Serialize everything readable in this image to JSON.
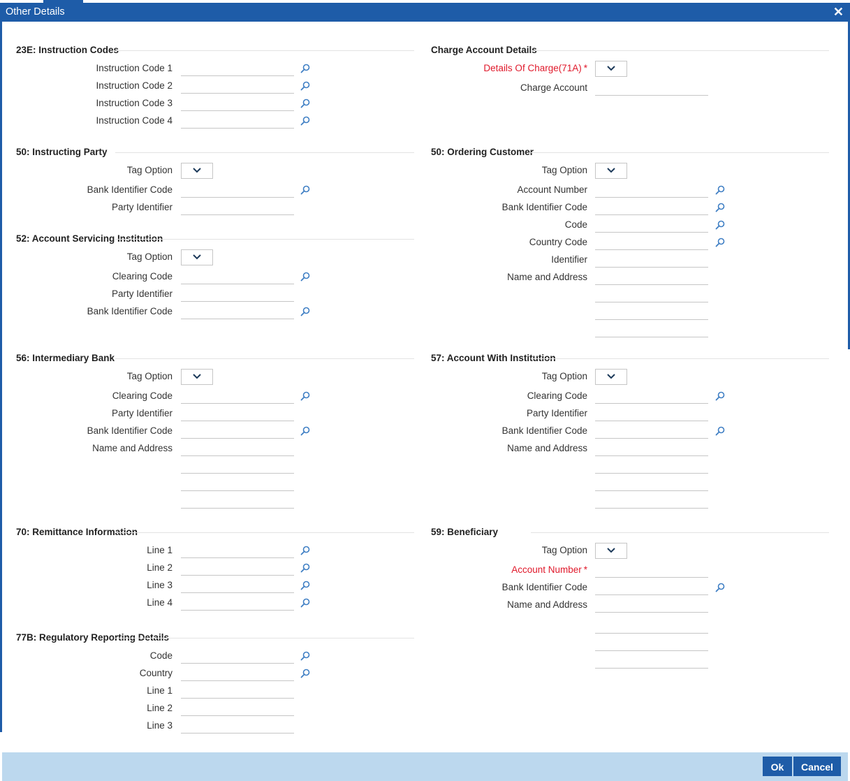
{
  "dialog": {
    "title": "Other Details"
  },
  "sections": {
    "instruction_codes": {
      "title": "23E: Instruction Codes",
      "labels": [
        "Instruction Code 1",
        "Instruction Code 2",
        "Instruction Code 3",
        "Instruction Code 4"
      ]
    },
    "charge_account": {
      "title": "Charge Account Details",
      "details_of_charge_label": "Details Of Charge(71A)",
      "charge_account_label": "Charge Account"
    },
    "instructing_party": {
      "title": "50: Instructing Party",
      "labels": [
        "Tag Option",
        "Bank Identifier Code",
        "Party Identifier"
      ]
    },
    "ordering_customer": {
      "title": "50: Ordering Customer",
      "labels": [
        "Tag Option",
        "Account Number",
        "Bank Identifier Code",
        "Code",
        "Country Code",
        "Identifier",
        "Name and Address"
      ]
    },
    "account_servicing": {
      "title": "52: Account Servicing Institution",
      "labels": [
        "Tag Option",
        "Clearing Code",
        "Party Identifier",
        "Bank Identifier Code"
      ]
    },
    "intermediary_bank": {
      "title": "56: Intermediary Bank",
      "labels": [
        "Tag Option",
        "Clearing Code",
        "Party Identifier",
        "Bank Identifier Code",
        "Name and Address"
      ]
    },
    "account_with": {
      "title": "57: Account With Institution",
      "labels": [
        "Tag Option",
        "Clearing Code",
        "Party Identifier",
        "Bank Identifier Code",
        "Name and Address"
      ]
    },
    "remittance": {
      "title": "70: Remittance Information",
      "labels": [
        "Line 1",
        "Line 2",
        "Line 3",
        "Line 4"
      ]
    },
    "beneficiary": {
      "title": "59: Beneficiary",
      "labels": [
        "Tag Option",
        "Account Number",
        "Bank Identifier Code",
        "Name and Address"
      ]
    },
    "regulatory": {
      "title": "77B: Regulatory Reporting Details",
      "labels": [
        "Code",
        "Country",
        "Line 1",
        "Line 2",
        "Line 3"
      ]
    }
  },
  "required_marker": "*",
  "icons": {
    "lookup": "search-icon",
    "dropdown": "chevron-down-icon",
    "close": "close-icon"
  },
  "colors": {
    "header": "#1e5ca8",
    "footer": "#bcd8ee",
    "required": "#e0192b"
  },
  "buttons": {
    "ok": "Ok",
    "cancel": "Cancel"
  }
}
